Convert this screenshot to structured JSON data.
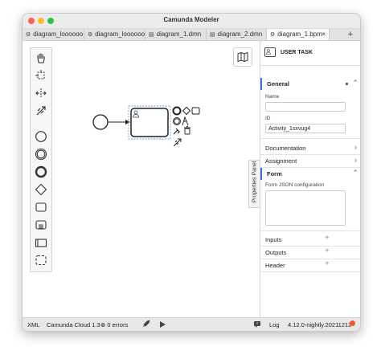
{
  "window": {
    "title": "Camunda Modeler"
  },
  "tabs": [
    {
      "label": "diagram_loooooo",
      "icon": "gear-icon"
    },
    {
      "label": "diagram_loooooo",
      "icon": "gear-icon"
    },
    {
      "label": "diagram_1.dmn",
      "icon": "table-icon"
    },
    {
      "label": "diagram_2.dmn",
      "icon": "table-icon"
    },
    {
      "label": "diagram_1.bpm",
      "icon": "gear-icon",
      "active": true,
      "close": "×"
    }
  ],
  "new_tab_label": "+",
  "palette": [
    "hand-tool-icon",
    "lasso-tool-icon",
    "space-tool-icon",
    "connect-tool-icon",
    "start-event-icon",
    "intermediate-event-icon",
    "end-event-icon",
    "gateway-icon",
    "task-icon",
    "subprocess-icon",
    "pool-icon",
    "group-icon"
  ],
  "properties_panel_toggle": "Properties Panel",
  "properties": {
    "header_type": "USER TASK",
    "general": {
      "title": "General",
      "name_label": "Name",
      "name_value": "",
      "id_label": "ID",
      "id_value": "Activity_1sxvug4"
    },
    "groups": {
      "documentation": "Documentation",
      "assignment": "Assignment",
      "form": "Form",
      "form_json_label": "Form JSON configuration",
      "inputs": "Inputs",
      "outputs": "Outputs",
      "header": "Header"
    },
    "plus_symbol": "+"
  },
  "statusbar": {
    "xml": "XML",
    "engine": "Camunda Cloud 1.3",
    "errors": "0 errors",
    "log": "Log",
    "version": "4.12.0-nightly.20211212"
  },
  "colors": {
    "accent": "#3b6de0",
    "update_dot": "#f05a28"
  }
}
